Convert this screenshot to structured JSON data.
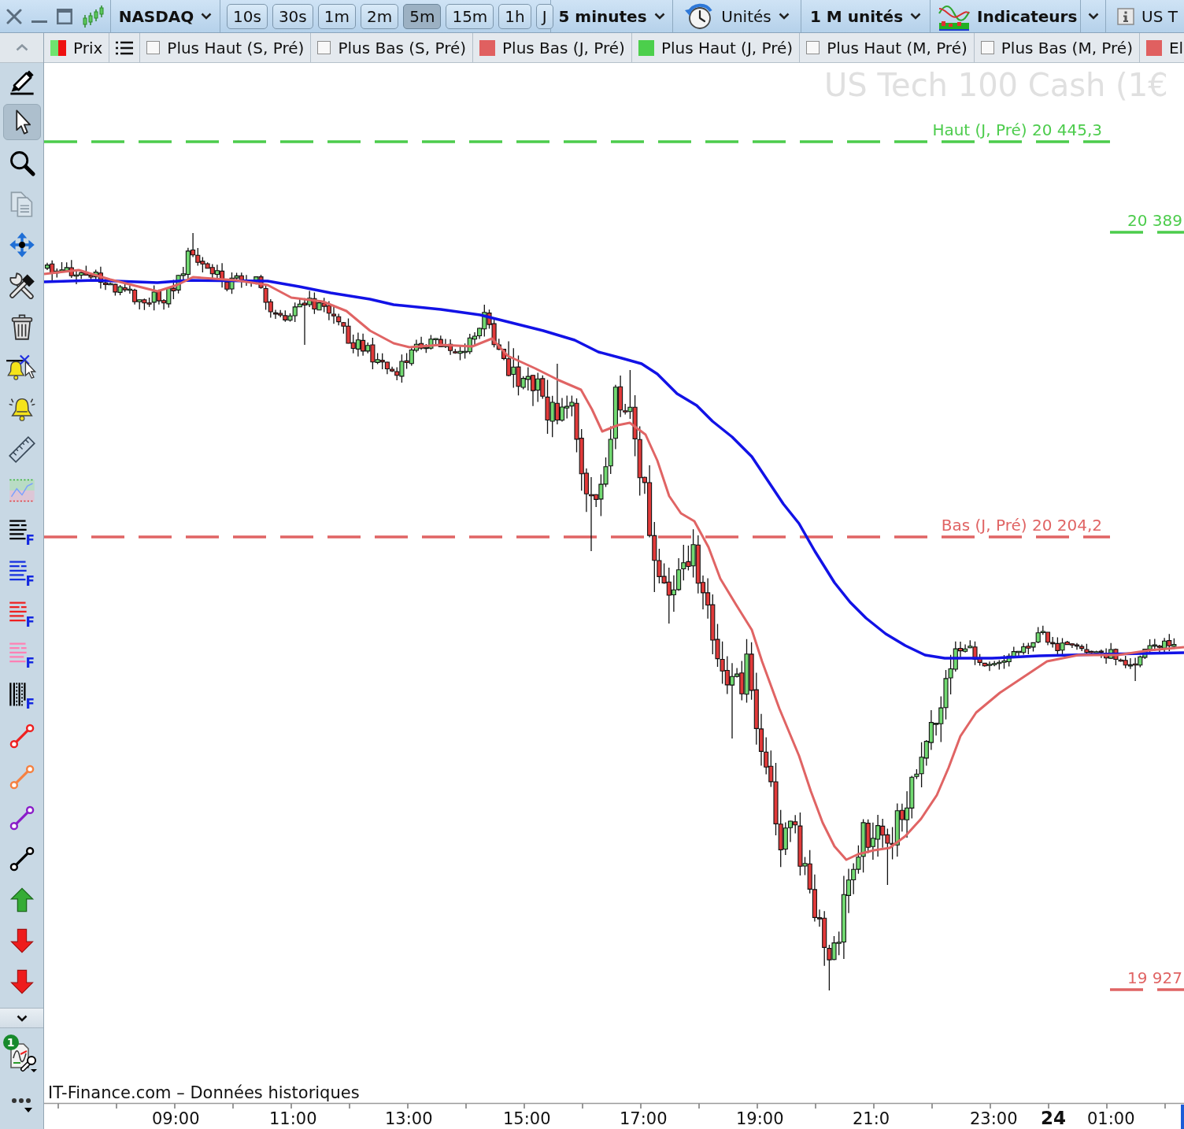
{
  "toolbar": {
    "symbol": "NASDAQ",
    "timeframes": [
      {
        "label": "10s",
        "selected": false
      },
      {
        "label": "30s",
        "selected": false
      },
      {
        "label": "1m",
        "selected": false
      },
      {
        "label": "2m",
        "selected": false
      },
      {
        "label": "5m",
        "selected": true
      },
      {
        "label": "15m",
        "selected": false
      },
      {
        "label": "1h",
        "selected": false
      },
      {
        "label": "J",
        "selected": false
      }
    ],
    "period": "5 minutes",
    "units": "Unités",
    "quantity": "1 M unités",
    "indicators": "Indicateurs",
    "instrument": "US T"
  },
  "legend": [
    {
      "kind": "price",
      "label": "Prix"
    },
    {
      "kind": "list"
    },
    {
      "kind": "toggle",
      "label": "Plus Haut (S, Pré)",
      "checked": false
    },
    {
      "kind": "toggle",
      "label": "Plus Bas (S, Pré)",
      "checked": false
    },
    {
      "kind": "toggle",
      "label": "Plus Bas (J, Pré)",
      "checked": true,
      "color": "#e06060"
    },
    {
      "kind": "toggle",
      "label": "Plus Haut (J, Pré)",
      "checked": true,
      "color": "#4ccf4c"
    },
    {
      "kind": "toggle",
      "label": "Plus Haut (M, Pré)",
      "checked": false
    },
    {
      "kind": "toggle",
      "label": "Plus Bas (M, Pré)",
      "checked": false
    },
    {
      "kind": "toggle",
      "label": "El",
      "checked": true,
      "color": "#e06060"
    }
  ],
  "sidebar": {
    "tools": [
      {
        "kind": "pencil",
        "selected": false,
        "disabled": false
      },
      {
        "kind": "pointer",
        "selected": true,
        "disabled": false
      },
      {
        "kind": "zoom",
        "selected": false,
        "disabled": false
      },
      {
        "kind": "copy",
        "selected": false,
        "disabled": true
      },
      {
        "kind": "move",
        "selected": false,
        "disabled": false
      },
      {
        "kind": "tools",
        "selected": false,
        "disabled": false
      },
      {
        "kind": "trash",
        "selected": false,
        "disabled": false
      },
      {
        "kind": "bell-cross",
        "selected": false,
        "disabled": false
      },
      {
        "kind": "bell",
        "selected": false,
        "disabled": false
      },
      {
        "kind": "ruler",
        "selected": false,
        "disabled": false
      },
      {
        "kind": "zone",
        "selected": false,
        "disabled": false
      },
      {
        "kind": "lines",
        "color": "#000000",
        "letter": "F",
        "selected": false,
        "disabled": false
      },
      {
        "kind": "lines",
        "color": "#1630e0",
        "letter": "F",
        "selected": false,
        "disabled": false
      },
      {
        "kind": "lines",
        "color": "#ee2020",
        "letter": "F",
        "selected": false,
        "disabled": false
      },
      {
        "kind": "lines",
        "color": "#ff80b4",
        "letter": "F",
        "selected": false,
        "disabled": false
      },
      {
        "kind": "columns",
        "letter": "F",
        "selected": false,
        "disabled": false
      },
      {
        "kind": "segment",
        "color": "#ee2020",
        "selected": false,
        "disabled": false
      },
      {
        "kind": "segment",
        "color": "#f58040",
        "selected": false,
        "disabled": false
      },
      {
        "kind": "segment",
        "color": "#8a1cc8",
        "selected": false,
        "disabled": false
      },
      {
        "kind": "segment",
        "color": "#000000",
        "selected": false,
        "disabled": false
      },
      {
        "kind": "arrow-up",
        "selected": false,
        "disabled": false
      },
      {
        "kind": "arrow-down",
        "selected": false,
        "disabled": false
      },
      {
        "kind": "arrow-down",
        "selected": false,
        "disabled": false
      }
    ],
    "badge": "1"
  },
  "chart": {
    "title": "US Tech 100 Cash (1€",
    "levels": [
      {
        "kind": "dashed",
        "label": "Haut (J, Pré) 20 445,3",
        "color": "#4ccc4c"
      },
      {
        "kind": "marker",
        "label": "20 389",
        "color": "#4ccc4c"
      },
      {
        "kind": "dashed",
        "label": "Bas (J, Pré) 20 204,2",
        "color": "#e06464"
      },
      {
        "kind": "marker",
        "label": "19 927",
        "color": "#e06464"
      }
    ],
    "source": "IT-Finance.com – Données historiques",
    "time_axis": [
      {
        "label": "09:00",
        "kind": "hour"
      },
      {
        "label": "11:00",
        "kind": "hour"
      },
      {
        "label": "13:00",
        "kind": "hour"
      },
      {
        "label": "15:00",
        "kind": "hour"
      },
      {
        "label": "17:00",
        "kind": "hour"
      },
      {
        "label": "19:00",
        "kind": "hour"
      },
      {
        "label": "21:0",
        "kind": "hour"
      },
      {
        "label": "23:00",
        "kind": "hour"
      },
      {
        "label": "24",
        "kind": "day"
      },
      {
        "label": "01:00",
        "kind": "hour"
      }
    ]
  }
}
